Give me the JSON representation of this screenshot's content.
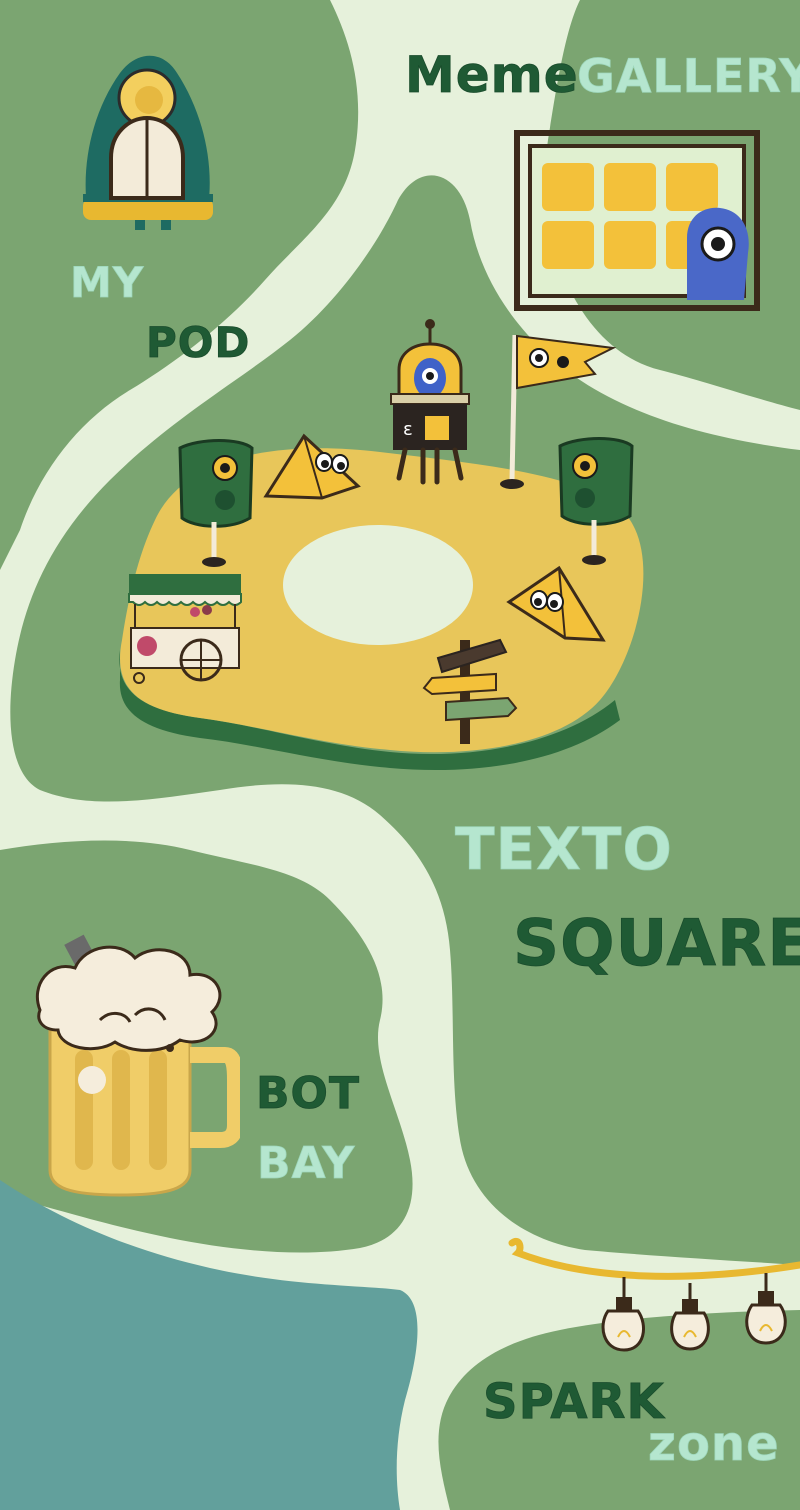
{
  "zones": {
    "my_pod": {
      "line1": "MY",
      "line2": "POD"
    },
    "meme_gallery": {
      "line1": "Meme",
      "line2": "GALLERY"
    },
    "texto_square": {
      "line1": "TEXTO",
      "line2": "SQUARE"
    },
    "bot_bay": {
      "line1": "BOT",
      "line2": "BAY"
    },
    "spark_zone": {
      "line1": "SPARK",
      "line2": "zone"
    }
  },
  "icons": [
    "pod-house-icon",
    "meme-frame-icon",
    "robot-icon",
    "flag-icon",
    "speaker-icon",
    "cone-sign-icon",
    "food-cart-icon",
    "signpost-icon",
    "beer-mug-icon",
    "light-bulbs-icon"
  ],
  "colors": {
    "path": "#e6f1db",
    "land": "#7ba571",
    "plaza": "#e8c65a",
    "water": "#62a09c",
    "label_dark": "#1f5a34",
    "label_light": "#b5e6cf"
  }
}
